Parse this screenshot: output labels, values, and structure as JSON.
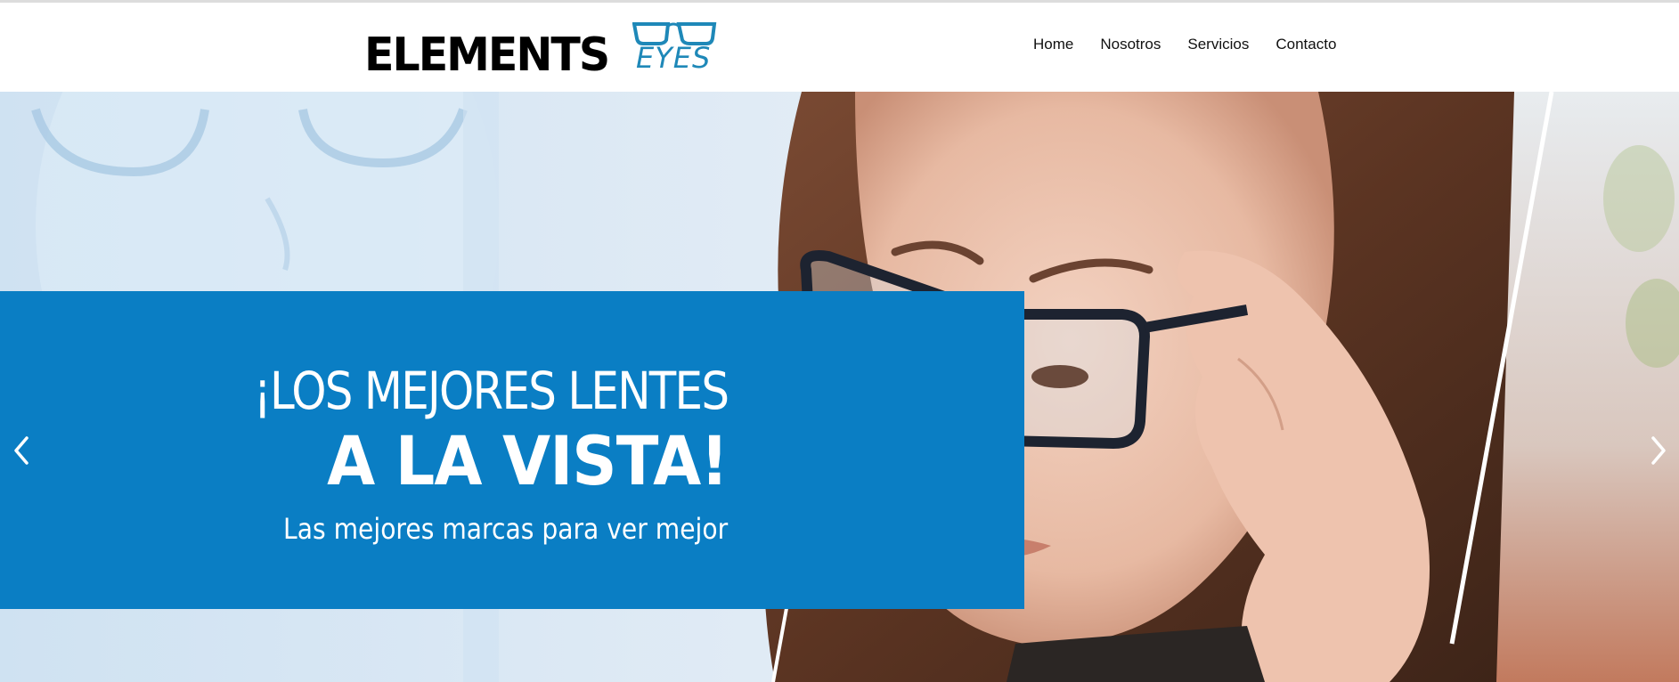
{
  "brand": {
    "wordmark": "ELEMENTS",
    "sub_wordmark": "EYES",
    "wordmark_color": "#000000",
    "accent_color": "#1e88b8"
  },
  "nav": {
    "items": [
      {
        "label": "Home"
      },
      {
        "label": "Nosotros"
      },
      {
        "label": "Servicios"
      },
      {
        "label": "Contacto"
      }
    ]
  },
  "hero": {
    "headline_line1": "¡LOS MEJORES LENTES",
    "headline_line2": "A LA VISTA!",
    "subheadline": "Las mejores marcas para ver mejor",
    "band_color": "#0a7ec4",
    "prev_icon": "chevron-left-icon",
    "next_icon": "chevron-right-icon"
  }
}
